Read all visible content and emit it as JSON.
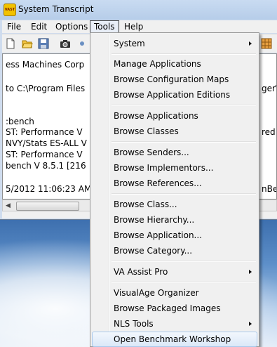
{
  "window": {
    "title": "System Transcript",
    "app_icon_text": "VAST"
  },
  "menubar": {
    "items": [
      "File",
      "Edit",
      "Options",
      "Tools",
      "Help"
    ],
    "open_item": "Tools"
  },
  "transcript": {
    "lines": [
      "ess Machines Corp",
      "to C:\\Program Files",
      ":bench",
      " ST: Performance V",
      "NVY/Stats ES-ALL V",
      " ST: Performance V",
      "bench V 8.5.1  [216",
      "5/2012 11:06:23 AM"
    ],
    "right_fragments": [
      "ger\\",
      "red",
      "nBen"
    ]
  },
  "tools_menu": {
    "items": [
      {
        "label": "System",
        "submenu": true
      },
      {
        "label": "Manage Applications",
        "submenu": false
      },
      {
        "label": "Browse Configuration Maps",
        "submenu": false
      },
      {
        "label": "Browse Application Editions",
        "submenu": false
      },
      {
        "label": "Browse Applications",
        "submenu": false
      },
      {
        "label": "Browse Classes",
        "submenu": false
      },
      {
        "label": "Browse Senders...",
        "submenu": false
      },
      {
        "label": "Browse Implementors...",
        "submenu": false
      },
      {
        "label": "Browse References...",
        "submenu": false
      },
      {
        "label": "Browse Class...",
        "submenu": false
      },
      {
        "label": "Browse Hierarchy...",
        "submenu": false
      },
      {
        "label": "Browse Application...",
        "submenu": false
      },
      {
        "label": "Browse Category...",
        "submenu": false
      },
      {
        "label": "VA Assist Pro",
        "submenu": true
      },
      {
        "label": "VisualAge Organizer",
        "submenu": false
      },
      {
        "label": "Browse Packaged Images",
        "submenu": false
      },
      {
        "label": "NLS Tools",
        "submenu": true
      },
      {
        "label": "Open Benchmark Workshop",
        "submenu": false,
        "highlighted": true
      }
    ]
  },
  "colors": {
    "menu_highlight": "#dbe8f8",
    "titlebar": "#c9dbf1"
  }
}
